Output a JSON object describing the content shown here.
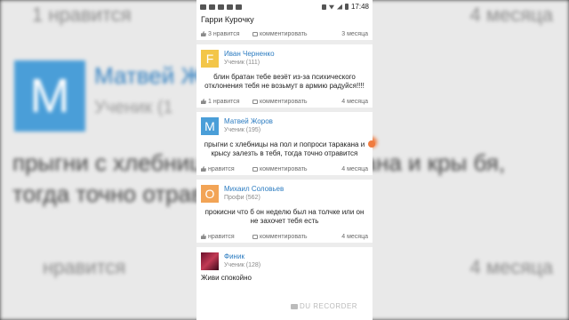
{
  "background": {
    "top_like": "1 нравится",
    "top_date": "4 месяца",
    "name": "Матвей Ж",
    "subtitle": "Ученик (1",
    "avatar_letter": "М",
    "text": "прыгни с хлебниц     попроси таракана и кры      бя, тогда точно отравится",
    "bottom_like": "нравится",
    "bottom_date": "4 месяца"
  },
  "status_bar": {
    "time": "17:48"
  },
  "feed": {
    "top_author": "Гарри Курочку",
    "top_meta": {
      "likes": "3 нравится",
      "comment": "комментировать",
      "date": "3 месяца"
    },
    "answers": [
      {
        "avatar_letter": "F",
        "avatar_color": "#f3c649",
        "name": "Иван Черненко",
        "rank": "Ученик (111)",
        "text": "блин братан тебе везёт из-за психического отклонения тебя не возьмут в армию радуйся!!!!",
        "likes": "1 нравится",
        "comment": "комментировать",
        "date": "4 месяца"
      },
      {
        "avatar_letter": "М",
        "avatar_color": "#4a9ed8",
        "name": "Матвей Жоров",
        "rank": "Ученик (195)",
        "text": "прыгни с хлебницы на пол и попроси таракана и крысу залезть в тебя, тогда точно отравится",
        "likes": "нравится",
        "comment": "комментировать",
        "date": "4 месяца"
      },
      {
        "avatar_letter": "О",
        "avatar_color": "#f2a456",
        "name": "Михаил Соловьев",
        "rank": "Профи (562)",
        "text": "прокисни что б он неделю был на толчке или он не захочет тебя есть",
        "likes": "нравится",
        "comment": "комментировать",
        "date": "4 месяца"
      },
      {
        "avatar_letter": "",
        "avatar_color": "#8a1d3a",
        "name": "Финик",
        "rank": "Ученик (128)",
        "text": "Живи спокойно"
      }
    ]
  },
  "watermark": "DU RECORDER"
}
